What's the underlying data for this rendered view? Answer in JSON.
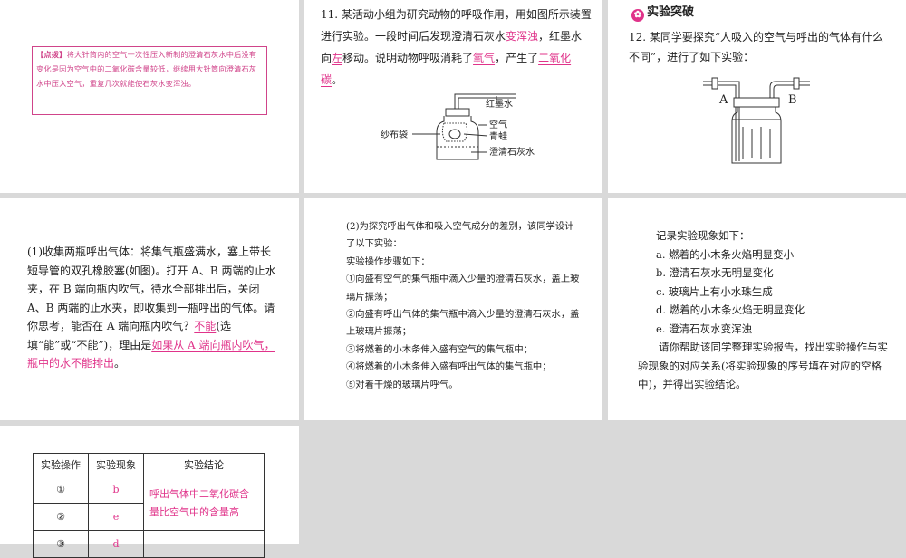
{
  "tip": {
    "tag": "【点拨】",
    "text": "将大针筒内的空气一次性压入新制的澄清石灰水中后没有变化是因为空气中的二氧化碳含量较低，继续用大针筒向澄清石灰水中压入空气，重复几次就能使石灰水变浑浊。"
  },
  "q11": {
    "lead": "11. 某活动小组为研究动物的呼吸作用，用如图所示装置进行实验。一段时间后发现澄清石灰水",
    "ans1": "变浑浊",
    "mid1": "，红墨水向",
    "ans2": "左",
    "mid2": "移动。说明动物呼吸消耗了",
    "ans3": "氧气",
    "mid3": "，产生了",
    "ans4": "二氧化碳",
    "end": "。",
    "figure": {
      "red_ink": "红墨水",
      "air": "空气",
      "frog": "青蛙",
      "bag": "纱布袋",
      "lime": "澄清石灰水"
    }
  },
  "header": {
    "icon": "✿",
    "title": "实验突破"
  },
  "q12": {
    "text": "12. 某同学要探究“人吸入的空气与呼出的气体有什么不同”，进行了如下实验：",
    "label_a": "A",
    "label_b": "B"
  },
  "part1": {
    "text1": "(1)收集两瓶呼出气体：将集气瓶盛满水，塞上带长短导管的双孔橡胶塞(如图)。打开 A、B 两端的止水夹，在 B 端向瓶内吹气，待水全部排出后，关闭 A、B 两端的止水夹，即收集到一瓶呼出的气体。请你思考，能否在 A 端向瓶内吹气？",
    "ans1": "不能",
    "text2": "(选填“能”或“不能”)，理由是",
    "ans2": "如果从 A 端向瓶内吹气，瓶中的水不能排出",
    "end": "。"
  },
  "part2": {
    "intro": "(2)为探究呼出气体和吸入空气成分的差别，该同学设计了以下实验：",
    "steps_title": "实验操作步骤如下：",
    "steps": [
      "①向盛有空气的集气瓶中滴入少量的澄清石灰水，盖上玻璃片振荡；",
      "②向盛有呼出气体的集气瓶中滴入少量的澄清石灰水，盖上玻璃片振荡；",
      "③将燃着的小木条伸入盛有空气的集气瓶中；",
      "④将燃着的小木条伸入盛有呼出气体的集气瓶中；",
      "⑤对着干燥的玻璃片呼气。"
    ]
  },
  "phenomena": {
    "title": "记录实验现象如下：",
    "items": [
      "a. 燃着的小木条火焰明显变小",
      "b. 澄清石灰水无明显变化",
      "c. 玻璃片上有小水珠生成",
      "d. 燃着的小木条火焰无明显变化",
      "e. 澄清石灰水变浑浊"
    ],
    "request": "请你帮助该同学整理实验报告，找出实验操作与实验现象的对应关系(将实验现象的序号填在对应的空格中)，并得出实验结论。"
  },
  "table": {
    "headers": [
      "实验操作",
      "实验现象",
      "实验结论"
    ],
    "rows": [
      {
        "op": "①",
        "ph": "b"
      },
      {
        "op": "②",
        "ph": "e"
      },
      {
        "op": "③",
        "ph": "d"
      }
    ],
    "conclusion": "呼出气体中二氧化碳含量比空气中的含量高"
  }
}
